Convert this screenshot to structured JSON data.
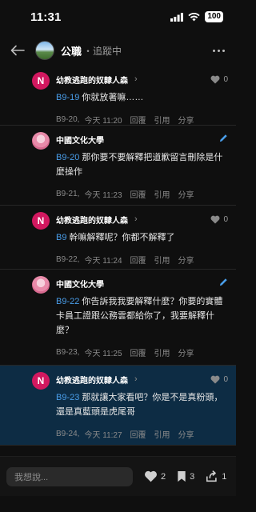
{
  "status": {
    "time": "11:31",
    "battery": "100"
  },
  "header": {
    "board_name": "公職",
    "follow_status": "・追蹤中"
  },
  "comments": [
    {
      "author": "幼教逃跑的奴隸人森",
      "avatar_letter": "N",
      "likes": "0",
      "ref": "B9-19",
      "text": "你就放著嘛……",
      "floor": "B9-20,",
      "time": "今天 11:20",
      "reply": "回覆",
      "quote": "引用",
      "share": "分享"
    },
    {
      "author": "中國文化大學",
      "ref": "B9-20",
      "text": "那你要不要解釋把道歉留言刪除是什麼操作",
      "floor": "B9-21,",
      "time": "今天 11:23",
      "reply": "回覆",
      "quote": "引用",
      "share": "分享"
    },
    {
      "author": "幼教逃跑的奴隸人森",
      "avatar_letter": "N",
      "likes": "0",
      "ref": "B9",
      "text": "幹嘛解釋呢？你都不解釋了",
      "floor": "B9-22,",
      "time": "今天 11:24",
      "reply": "回覆",
      "quote": "引用",
      "share": "分享"
    },
    {
      "author": "中國文化大學",
      "ref": "B9-22",
      "text": "你告訴我我要解釋什麼？你要的實體卡員工證跟公務雲都給你了，我要解釋什麼？",
      "floor": "B9-23,",
      "time": "今天 11:25",
      "reply": "回覆",
      "quote": "引用",
      "share": "分享"
    },
    {
      "author": "幼教逃跑的奴隸人森",
      "avatar_letter": "N",
      "likes": "0",
      "ref": "B9-23",
      "text": "那就讓大家看吧？你是不是真粉頭，還是真藍頭是虎尾哥",
      "floor": "B9-24,",
      "time": "今天 11:27",
      "reply": "回覆",
      "quote": "引用",
      "share": "分享"
    }
  ],
  "bottom": {
    "placeholder": "我想說...",
    "likes": "2",
    "bookmarks": "3",
    "shares": "1"
  },
  "colors": {
    "accent": "#4a9eea",
    "highlight_bg": "#0d2c44",
    "avatar_n": "#d2185f"
  }
}
